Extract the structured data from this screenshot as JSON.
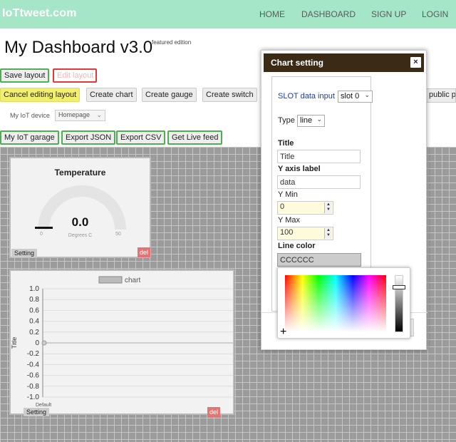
{
  "nav": {
    "brand": "IoTtweet.com",
    "items": [
      "HOME",
      "DASHBOARD",
      "SIGN UP",
      "LOGIN"
    ]
  },
  "page": {
    "title": "My Dashboard v3.0",
    "edition": "featured edition"
  },
  "toolbar": {
    "save_layout": "Save layout",
    "edit_layout": "Edit layout",
    "cancel_editing": "Cancel editing layout",
    "create_chart": "Create chart",
    "create_gauge": "Create gauge",
    "create_switch": "Create switch",
    "public_page": "public pa",
    "device_label": "My IoT device",
    "device_selected": "Homepage",
    "my_garage": "My IoT garage",
    "export_json": "Export JSON",
    "export_csv": "Export CSV",
    "live_feed": "Get Live feed"
  },
  "gauge": {
    "title": "Temperature",
    "value": "0.0",
    "unit": "Degrees C",
    "min": "0",
    "max": "50",
    "level": 0,
    "setting": "Setting",
    "del": "del"
  },
  "chart": {
    "legend": "chart",
    "ylabel": "Title",
    "xlabel": "Default",
    "ticks": [
      "1.0",
      "0.8",
      "0.6",
      "0.4",
      "0.2",
      "0",
      "-0.2",
      "-0.4",
      "-0.6",
      "-0.8",
      "-1.0"
    ],
    "setting": "Setting",
    "del": "del",
    "chart_data": {
      "type": "line",
      "ylim": [
        -1.0,
        1.0
      ],
      "series": [
        {
          "name": "chart",
          "values": [
            0
          ]
        }
      ]
    }
  },
  "modal": {
    "title": "Chart setting",
    "close": "×",
    "slot_label": "SLOT data input",
    "slot_value": "slot 0",
    "type_label": "Type",
    "type_value": "line",
    "title_label": "Title",
    "title_value": "Title",
    "yaxis_label": "Y axis label",
    "yaxis_value": "data",
    "ymin_label": "Y Min",
    "ymin_value": "0",
    "ymax_label": "Y Max",
    "ymax_value": "100",
    "color_label": "Line color",
    "color_value": "CCCCCC"
  },
  "colors": {
    "navbar": "#a5e6c8",
    "modal_header": "#3b2b16",
    "accent_green": "#4caf50",
    "accent_red": "#e53935",
    "cancel_yellow": "#f2ee6e",
    "line_color": "#CCCCCC"
  }
}
